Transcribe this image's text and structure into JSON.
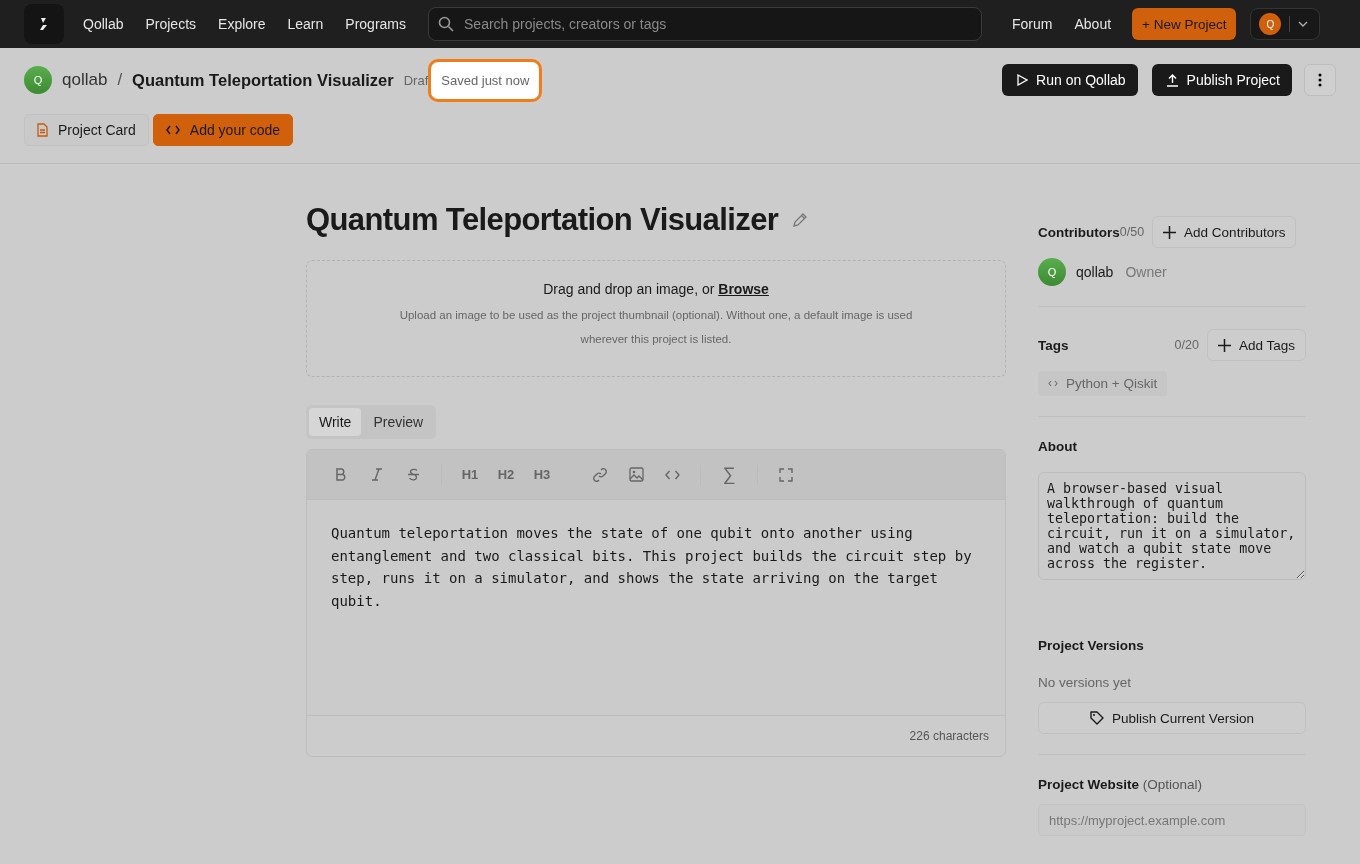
{
  "topbar": {
    "brand": "Qollab",
    "nav": [
      "Projects",
      "Explore",
      "Learn",
      "Programs"
    ],
    "search": {
      "placeholder": "Search projects, creators or tags"
    },
    "links": [
      "Forum",
      "About"
    ],
    "new_button": "+ New Project",
    "avatar": "Q"
  },
  "header": {
    "owner_avatar": "Q",
    "owner": "qollab",
    "separator": "/",
    "title": "Quantum Teleportation Visualizer",
    "status": "Draf",
    "toast": "Saved just now",
    "run_button": "Run on Qollab",
    "publish_button": "Publish Project",
    "tabs": [
      {
        "label": "Project Card",
        "selected": false
      },
      {
        "label": "Add your code",
        "selected": true
      }
    ]
  },
  "main": {
    "title": "Quantum Teleportation Visualizer",
    "dropzone": {
      "prompt": "Drag and drop an image, or ",
      "link": "Browse",
      "hint": "Upload an image to be used as the project thumbnail (optional). Without one, a default image is used wherever this project is listed."
    },
    "editor_tabs": [
      {
        "label": "Write",
        "selected": true
      },
      {
        "label": "Preview",
        "selected": false
      }
    ],
    "toolbar": {
      "headings": [
        "H1",
        "H2",
        "H3"
      ],
      "symbol": "∑"
    },
    "body": "Quantum teleportation moves the state of one qubit onto another using entanglement and two classical bits. This project builds the circuit step by step, runs it on a simulator, and shows the state arriving on the target qubit.",
    "count": "226 characters"
  },
  "sidebar": {
    "contributors": {
      "title": "Contributors",
      "count": "0/50",
      "button": "Add Contributors",
      "people": [
        {
          "avatar": "Q",
          "name": "qollab",
          "role": "Owner"
        }
      ]
    },
    "tags": {
      "title": "Tags",
      "count": "0/20",
      "button": "Add Tags",
      "items": [
        "Python + Qiskit"
      ]
    },
    "about": {
      "title": "About",
      "value": "A browser-based visual walkthrough of quantum teleportation: build the circuit, run it on a simulator, and watch a qubit state move across the register."
    },
    "versions": {
      "title": "Project Versions",
      "empty": "No versions yet",
      "button": "Publish Current Version"
    },
    "website": {
      "title": "Project Website",
      "optional": "(Optional)",
      "placeholder": "https://myproject.example.com"
    }
  }
}
